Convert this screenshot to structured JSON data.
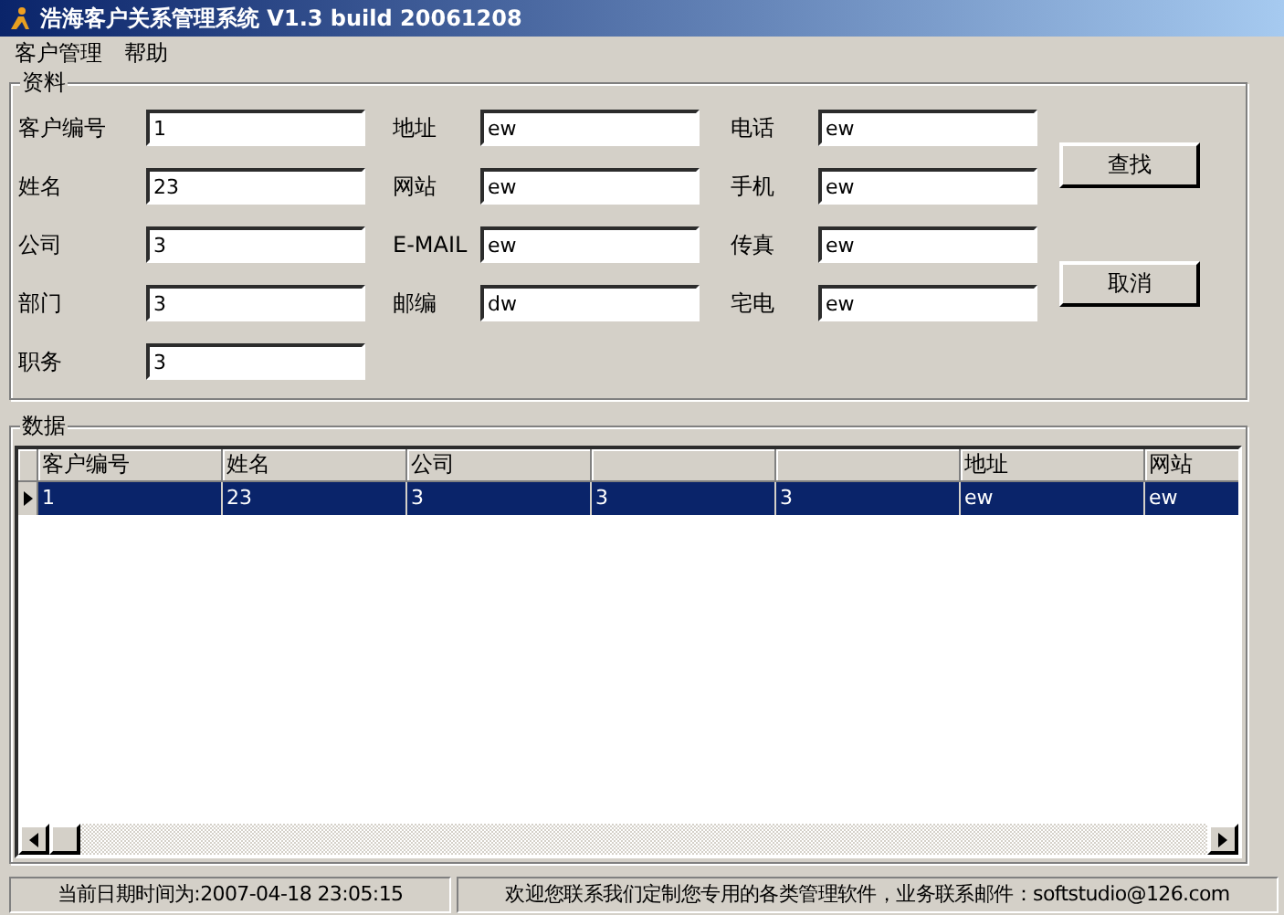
{
  "window": {
    "title": "浩海客户关系管理系统 V1.3 build 20061208"
  },
  "menu": [
    "客户管理",
    "帮助"
  ],
  "info_group": {
    "title": "资料",
    "field_columns": [
      [
        {
          "label": "客户编号",
          "value": "1"
        },
        {
          "label": "姓名",
          "value": "23"
        },
        {
          "label": "公司",
          "value": "3"
        },
        {
          "label": "部门",
          "value": "3"
        },
        {
          "label": "职务",
          "value": "3"
        }
      ],
      [
        {
          "label": "地址",
          "value": "ew"
        },
        {
          "label": "网站",
          "value": "ew"
        },
        {
          "label": "E-MAIL",
          "value": "ew"
        },
        {
          "label": "邮编",
          "value": "dw"
        }
      ],
      [
        {
          "label": "电话",
          "value": "ew"
        },
        {
          "label": "手机",
          "value": "ew"
        },
        {
          "label": "传真",
          "value": "ew"
        },
        {
          "label": "宅电",
          "value": "ew"
        }
      ]
    ],
    "buttons": [
      "查找",
      "取消"
    ]
  },
  "data_group": {
    "title": "数据",
    "columns": [
      {
        "label": "客户编号"
      },
      {
        "label": "姓名"
      },
      {
        "label": "公司"
      },
      {},
      {},
      {
        "label": "地址"
      },
      {
        "label": "网站"
      }
    ],
    "rows": [
      {
        "selected": true,
        "cells": [
          "1",
          "23",
          "3",
          "3",
          "3",
          "ew",
          "ew"
        ]
      }
    ]
  },
  "status_bar": [
    "当前日期时间为:2007-04-18 23:05:15",
    "欢迎您联系我们定制您专用的各类管理软件，业务联系邮件：softstudio@126.com"
  ]
}
